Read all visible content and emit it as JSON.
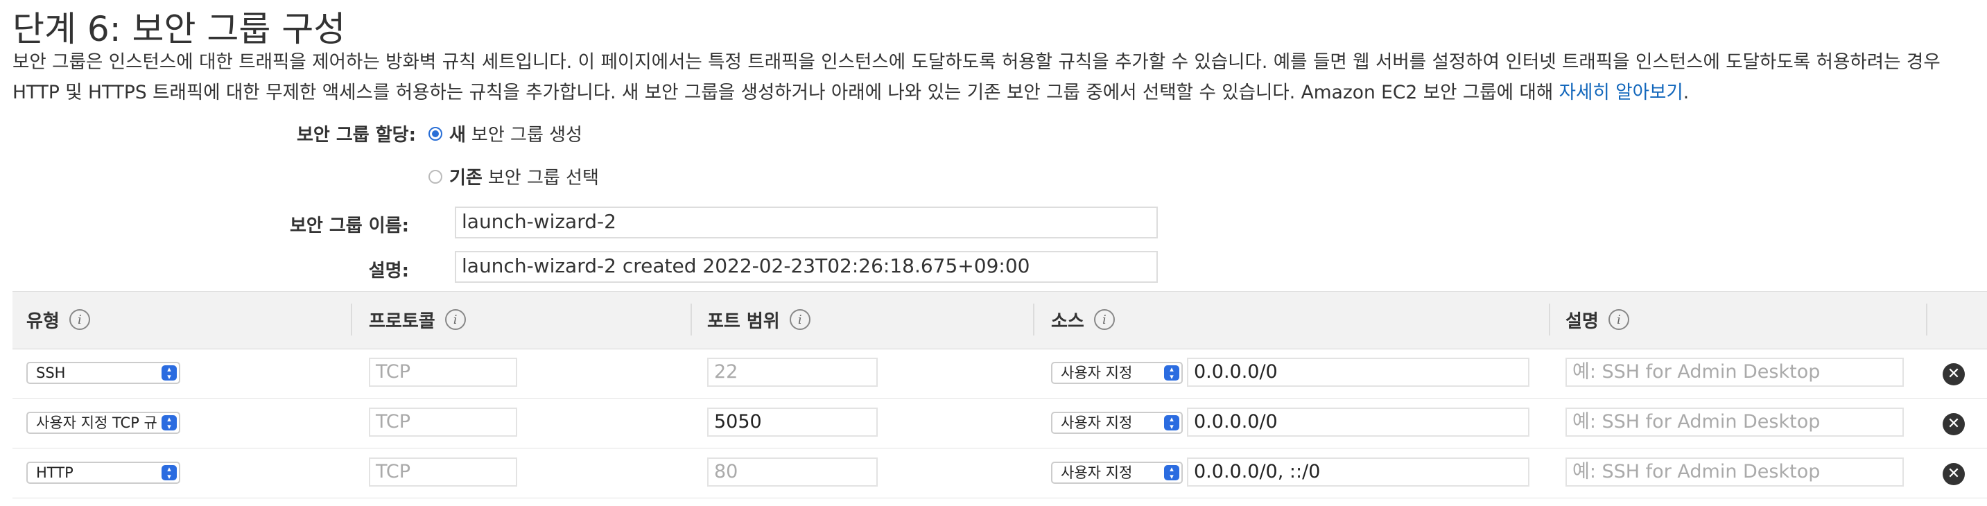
{
  "page": {
    "title": "단계 6: 보안 그룹 구성",
    "description": "보안 그룹은 인스턴스에 대한 트래픽을 제어하는 방화벽 규칙 세트입니다. 이 페이지에서는 특정 트래픽을 인스턴스에 도달하도록 허용할 규칙을 추가할 수 있습니다. 예를 들면 웹 서버를 설정하여 인터넷 트래픽을 인스턴스에 도달하도록 허용하려는 경우 HTTP 및 HTTPS 트래픽에 대한 무제한 액세스를 허용하는 규칙을 추가합니다. 새 보안 그룹을 생성하거나 아래에 나와 있는 기존 보안 그룹 중에서 선택할 수 있습니다. Amazon EC2 보안 그룹에 대해 ",
    "learn_more_link": "자세히 알아보기",
    "description_end": "."
  },
  "form": {
    "assign_label": "보안 그룹 할당:",
    "option_new_bold": "새",
    "option_new_rest": "보안 그룹 생성",
    "option_existing_bold": "기존",
    "option_existing_rest": "보안 그룹 선택",
    "name_label": "보안 그룹 이름:",
    "name_value": "launch-wizard-2",
    "desc_label": "설명:",
    "desc_value": "launch-wizard-2 created 2022-02-23T02:26:18.675+09:00"
  },
  "table": {
    "headers": {
      "type": "유형",
      "protocol": "프로토콜",
      "port_range": "포트 범위",
      "source": "소스",
      "description": "설명"
    },
    "info_glyph": "i",
    "remove_glyph": "✕",
    "rows": [
      {
        "type": "SSH",
        "protocol": "TCP",
        "port": "22",
        "port_editable": false,
        "source_mode": "사용자 지정",
        "source_value": "0.0.0.0/0",
        "description_placeholder": "예: SSH for Admin Desktop"
      },
      {
        "type": "사용자 지정 TCP 규",
        "protocol": "TCP",
        "port": "5050",
        "port_editable": true,
        "source_mode": "사용자 지정",
        "source_value": "0.0.0.0/0",
        "description_placeholder": "예: SSH for Admin Desktop"
      },
      {
        "type": "HTTP",
        "protocol": "TCP",
        "port": "80",
        "port_editable": false,
        "source_mode": "사용자 지정",
        "source_value": "0.0.0.0/0, ::/0",
        "description_placeholder": "예: SSH for Admin Desktop"
      }
    ]
  },
  "colors": {
    "link": "#1166bb",
    "radio_selected": "#2a6fd6",
    "select_arrow": "#2b6ce0",
    "header_bg": "#f2f2f2"
  },
  "icons": {
    "info": "info-icon",
    "remove": "close-circle-icon",
    "select_arrow": "chevron-updown-icon"
  }
}
